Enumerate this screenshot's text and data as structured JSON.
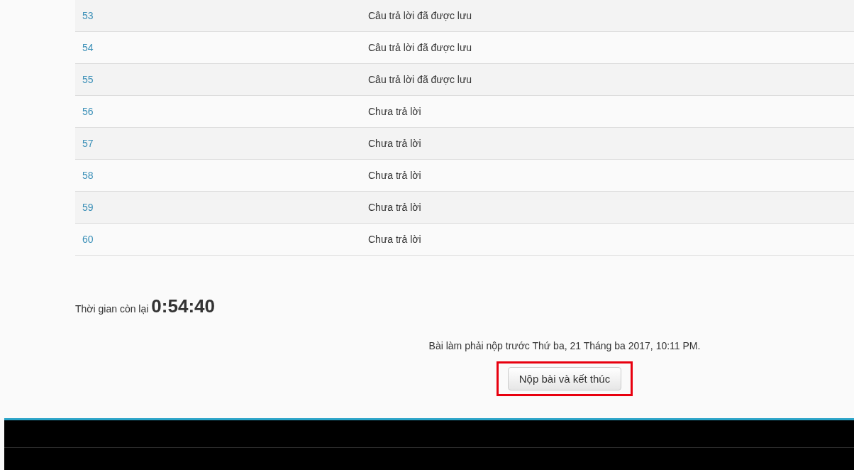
{
  "summary_table": {
    "rows": [
      {
        "question": "53",
        "status": "Câu trả lời đã được lưu"
      },
      {
        "question": "54",
        "status": "Câu trả lời đã được lưu"
      },
      {
        "question": "55",
        "status": "Câu trả lời đã được lưu"
      },
      {
        "question": "56",
        "status": "Chưa trả lời"
      },
      {
        "question": "57",
        "status": "Chưa trả lời"
      },
      {
        "question": "58",
        "status": "Chưa trả lời"
      },
      {
        "question": "59",
        "status": "Chưa trả lời"
      },
      {
        "question": "60",
        "status": "Chưa trả lời"
      }
    ]
  },
  "timer": {
    "label": "Thời gian còn lại",
    "value": "0:54:40"
  },
  "deadline": "Bài làm phải nộp trước Thứ ba, 21 Tháng ba 2017, 10:11 PM.",
  "submit_button": {
    "label": "Nộp bài và kết thúc",
    "highlighted": true
  }
}
